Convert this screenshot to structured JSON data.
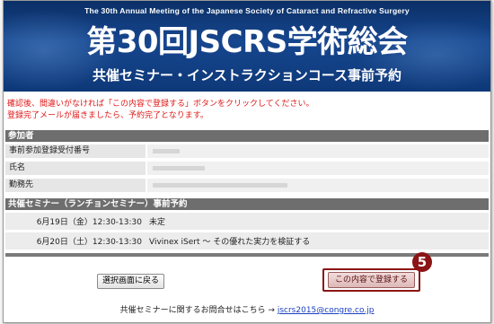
{
  "banner": {
    "subtitle": "The 30th Annual Meeting of the Japanese Society of Cataract and Refractive Surgery",
    "title": "第30回JSCRS学術総会",
    "caption": "共催セミナー・インストラクションコース事前予約"
  },
  "notice": {
    "line1": "確認後、間違いがなければ「この内容で登録する」ボタンをクリックしてください。",
    "line2": "登録完了メールが届きましたら、予約完了となります。"
  },
  "participant": {
    "header": "参加者",
    "rows": [
      {
        "label": "事前参加登録受付番号",
        "value": ""
      },
      {
        "label": "氏名",
        "value": ""
      },
      {
        "label": "勤務先",
        "value": ""
      }
    ]
  },
  "seminar": {
    "header": "共催セミナー（ランチョンセミナー）事前予約",
    "sessions": [
      {
        "date": "6月19日（金）12:30-13:30",
        "title": "未定"
      },
      {
        "date": "6月20日（土）12:30-13:30",
        "title": "Vivinex iSert 〜 その優れた実力を検証する"
      }
    ]
  },
  "buttons": {
    "back": "選択画面に戻る",
    "confirm": "この内容で登録する",
    "step_number": "5"
  },
  "footer": {
    "text": "共催セミナーに関するお問合せはこちら →",
    "email": "jscrs2015@congre.co.jp"
  },
  "colors": {
    "banner": "#16478f",
    "notice": "#e01818",
    "accent": "#8b1414",
    "link": "#1a3fbf"
  }
}
